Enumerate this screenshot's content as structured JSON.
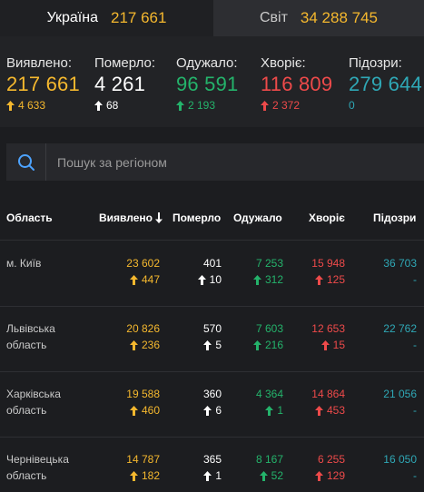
{
  "tabs": [
    {
      "name": "Україна",
      "count": "217 661"
    },
    {
      "name": "Світ",
      "count": "34 288 745"
    }
  ],
  "stats": [
    {
      "label": "Виявлено:",
      "value": "217 661",
      "delta": "4 633",
      "color": "#f5b82e"
    },
    {
      "label": "Померло:",
      "value": "4 261",
      "delta": "68",
      "color": "#ffffff"
    },
    {
      "label": "Одужало:",
      "value": "96 591",
      "delta": "2 193",
      "color": "#24b36b"
    },
    {
      "label": "Хворіє:",
      "value": "116 809",
      "delta": "2 372",
      "color": "#ee4a4a"
    },
    {
      "label": "Підозри:",
      "value": "279 644",
      "delta": "0",
      "color": "#2fa8b6"
    }
  ],
  "search": {
    "placeholder": "Пошук за регіоном"
  },
  "table": {
    "headers": [
      "Область",
      "Виявлено",
      "Померло",
      "Одужало",
      "Хворіє",
      "Підозри"
    ],
    "rows": [
      {
        "region": "м. Київ",
        "detected": "23 602",
        "detected_delta": "447",
        "died": "401",
        "died_delta": "10",
        "recovered": "7 253",
        "recovered_delta": "312",
        "sick": "15 948",
        "sick_delta": "125",
        "suspected": "36 703",
        "suspected_delta": "-"
      },
      {
        "region": "Львівська область",
        "detected": "20 826",
        "detected_delta": "236",
        "died": "570",
        "died_delta": "5",
        "recovered": "7 603",
        "recovered_delta": "216",
        "sick": "12 653",
        "sick_delta": "15",
        "suspected": "22 762",
        "suspected_delta": "-"
      },
      {
        "region": "Харківська область",
        "detected": "19 588",
        "detected_delta": "460",
        "died": "360",
        "died_delta": "6",
        "recovered": "4 364",
        "recovered_delta": "1",
        "sick": "14 864",
        "sick_delta": "453",
        "suspected": "21 056",
        "suspected_delta": "-"
      },
      {
        "region": "Чернівецька область",
        "detected": "14 787",
        "detected_delta": "182",
        "died": "365",
        "died_delta": "1",
        "recovered": "8 167",
        "recovered_delta": "52",
        "sick": "6 255",
        "sick_delta": "129",
        "suspected": "16 050",
        "suspected_delta": "-"
      }
    ]
  },
  "icons": {
    "sort": "arrow-down-icon",
    "search": "search-icon",
    "delta": "arrow-up-icon"
  }
}
